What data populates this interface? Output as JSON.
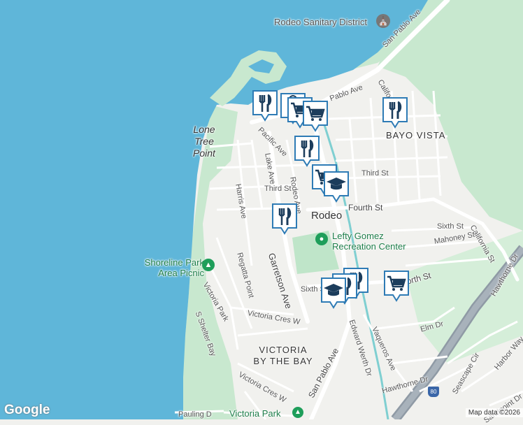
{
  "colors": {
    "water": "#5fb6d9",
    "land": "#f1f1ee",
    "park": "#bfe5c9",
    "road": "#ffffff",
    "highway": "#8f9aa5",
    "rail": "#7fcfd1",
    "marker_fill": "#ffffff",
    "marker_border": "#2e7bb5",
    "marker_icon": "#1c3d5c"
  },
  "labels": {
    "sanitary": "Rodeo Sanitary District",
    "san_pablo_ave_top": "San Pablo Ave",
    "pablo_ave": "Pablo Ave",
    "california_top": "California",
    "third_st_n": "Third St",
    "bayo_vista": "BAYO VISTA",
    "lone_tree": "Lone Tree Point",
    "pacific_ave": "Pacific Ave",
    "lake_ave": "Lake Ave",
    "third_st_w": "Third St",
    "rodeo_ave": "Rodeo Ave",
    "harris_ave": "Harris Ave",
    "fourth_st": "Fourth St",
    "rodeo": "Rodeo",
    "sixth_st_e": "Sixth St",
    "california_st": "California St",
    "mahoney_st": "Mahoney St",
    "lefty": "Lefty Gomez Recreation Center",
    "shoreline": "Shoreline Park Area Picnic",
    "regatta": "Regatta Point",
    "garretson": "Garretson Ave",
    "victoria_park_st": "Victoria Park",
    "sixth_st_w": "Sixth S",
    "fourth_st_e": "orth St",
    "hawthorne_dr_e": "Hawthorne Dr",
    "s_shelter": "S Shelter Bay",
    "victoria_cres_w1": "Victoria Cres W",
    "edward": "Edward Werth Dr",
    "vaqueros": "Vaqueros Ave",
    "elm": "Elm Dr",
    "victoria_bay": "VICTORIA BY THE BAY",
    "san_pablo_ave_bottom": "San Pablo Ave",
    "seascape": "Seascape Cir",
    "harbor_way": "Harbor Way",
    "hawthorne_dr_s": "Hawthorne Dr",
    "victoria_cres_w2": "Victoria Cres W",
    "i80": "80",
    "pauling": "Pauling D",
    "victoria_park": "Victoria Park",
    "sandpoint": "Sandpoint Dr"
  },
  "attribution": {
    "logo": "Google",
    "map_data": "Map data ©2026"
  },
  "markers": [
    {
      "icon": "restaurant-icon"
    },
    {
      "icon": "shopping-bag-icon"
    },
    {
      "icon": "shopping-cart-icon"
    },
    {
      "icon": "shopping-cart-icon"
    },
    {
      "icon": "restaurant-icon"
    },
    {
      "icon": "restaurant-icon"
    },
    {
      "icon": "shopping-cart-icon"
    },
    {
      "icon": "school-icon"
    },
    {
      "icon": "restaurant-icon"
    },
    {
      "icon": "restaurant-icon"
    },
    {
      "icon": "restaurant-icon"
    },
    {
      "icon": "school-icon"
    },
    {
      "icon": "shopping-cart-icon"
    }
  ]
}
